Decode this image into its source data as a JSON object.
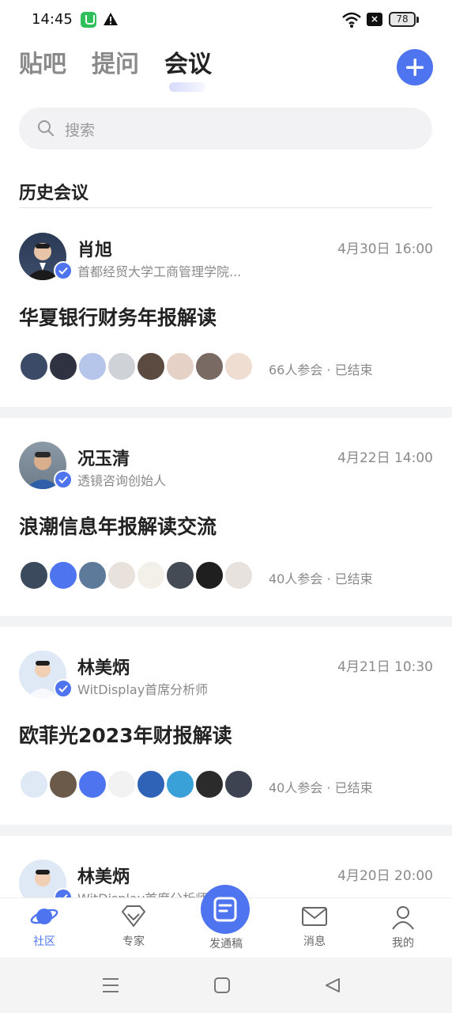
{
  "status_bar": {
    "time": "14:45",
    "battery": "78"
  },
  "top_tabs": [
    {
      "label": "贴吧",
      "active": false
    },
    {
      "label": "提问",
      "active": false
    },
    {
      "label": "会议",
      "active": true
    }
  ],
  "search": {
    "placeholder": "搜索"
  },
  "section_title": "历史会议",
  "meetings": [
    {
      "host_name": "肖旭",
      "host_title": "首都经贸大学工商管理学院...",
      "time": "4月30日 16:00",
      "title": "华夏银行财务年报解读",
      "participants_count": "66人参会",
      "status": "已结束"
    },
    {
      "host_name": "况玉清",
      "host_title": "透镜咨询创始人",
      "time": "4月22日 14:00",
      "title": "浪潮信息年报解读交流",
      "participants_count": "40人参会",
      "status": "已结束"
    },
    {
      "host_name": "林美炳",
      "host_title": "WitDisplay首席分析师",
      "time": "4月21日 10:30",
      "title": "欧菲光2023年财报解读",
      "participants_count": "40人参会",
      "status": "已结束"
    },
    {
      "host_name": "林美炳",
      "host_title": "WitDisplay首席分析师",
      "time": "4月20日 20:00"
    }
  ],
  "bottom_nav": {
    "community": "社区",
    "experts": "专家",
    "publish": "发通稿",
    "messages": "消息",
    "mine": "我的"
  },
  "colors": {
    "accent": "#4f74f0",
    "separator": "#f2f3f5"
  },
  "icons": [
    "wifi-icon",
    "warning-icon",
    "search-icon",
    "plus-icon",
    "planet-icon",
    "diamond-icon",
    "document-icon",
    "mail-icon",
    "person-icon",
    "verified-icon"
  ]
}
